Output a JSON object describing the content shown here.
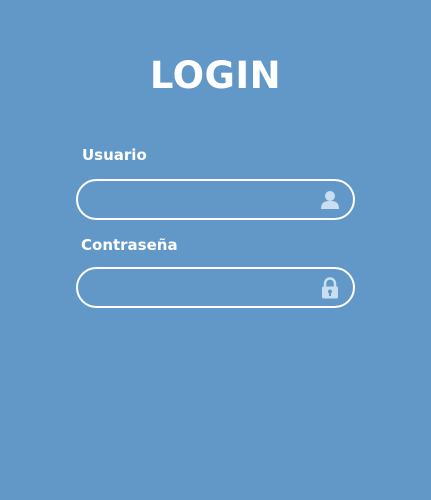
{
  "login": {
    "title": "LOGIN",
    "username": {
      "label": "Usuario",
      "value": "",
      "placeholder": "",
      "icon": "user-icon"
    },
    "password": {
      "label": "Contraseña",
      "value": "",
      "placeholder": "",
      "icon": "lock-icon"
    }
  },
  "colors": {
    "background": "#6198c8",
    "text": "#ffffff",
    "icon": "#c9def0"
  }
}
